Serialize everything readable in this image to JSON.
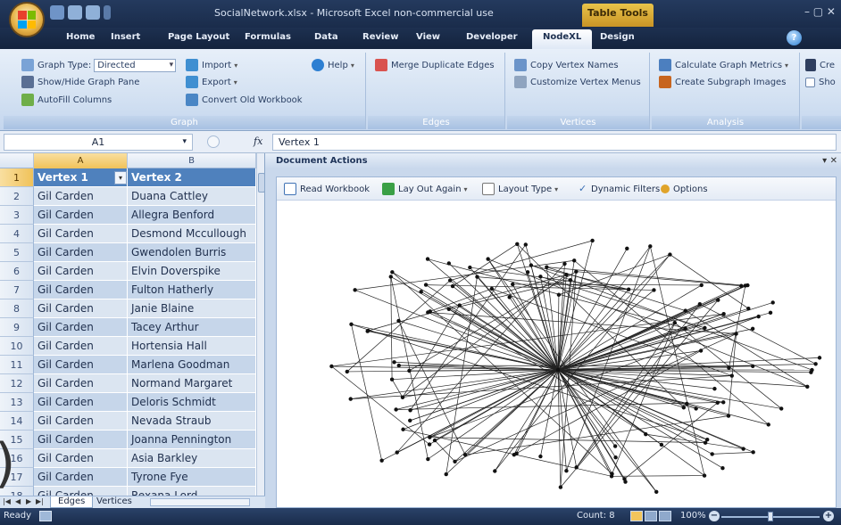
{
  "window": {
    "title": "SocialNetwork.xlsx - Microsoft Excel non-commercial use",
    "context_tab": "Table Tools",
    "controls": "– ▢ ✕"
  },
  "tabs": [
    "Home",
    "Insert",
    "Page Layout",
    "Formulas",
    "Data",
    "Review",
    "View",
    "Developer",
    "NodeXL",
    "Design"
  ],
  "active_tab": "NodeXL",
  "ribbon": {
    "graph": {
      "label": "Graph",
      "graph_type_label": "Graph Type:",
      "graph_type_value": "Directed",
      "show_hide": "Show/Hide Graph Pane",
      "autofill": "AutoFill Columns",
      "import": "Import",
      "export": "Export",
      "convert": "Convert Old Workbook",
      "help": "Help"
    },
    "edges": {
      "label": "Edges",
      "merge": "Merge Duplicate Edges"
    },
    "vertices": {
      "label": "Vertices",
      "copy": "Copy Vertex Names",
      "customize": "Customize Vertex Menus"
    },
    "analysis": {
      "label": "Analysis",
      "calculate": "Calculate Graph Metrics",
      "subgraph": "Create Subgraph Images",
      "cre": "Cre",
      "sho": "Sho"
    }
  },
  "formula_bar": {
    "name_box": "A1",
    "fx": "fx",
    "content": "Vertex 1"
  },
  "sheet": {
    "columns": [
      "A",
      "B"
    ],
    "header": [
      "Vertex 1",
      "Vertex 2"
    ],
    "rows": [
      [
        "Gil Carden",
        "Duana Cattley"
      ],
      [
        "Gil Carden",
        "Allegra Benford"
      ],
      [
        "Gil Carden",
        "Desmond Mccullough"
      ],
      [
        "Gil Carden",
        "Gwendolen Burris"
      ],
      [
        "Gil Carden",
        "Elvin Doverspike"
      ],
      [
        "Gil Carden",
        "Fulton Hatherly"
      ],
      [
        "Gil Carden",
        "Janie Blaine"
      ],
      [
        "Gil Carden",
        "Tacey Arthur"
      ],
      [
        "Gil Carden",
        "Hortensia Hall"
      ],
      [
        "Gil Carden",
        "Marlena Goodman"
      ],
      [
        "Gil Carden",
        "Normand Margaret"
      ],
      [
        "Gil Carden",
        "Deloris Schmidt"
      ],
      [
        "Gil Carden",
        "Nevada Straub"
      ],
      [
        "Gil Carden",
        "Joanna Pennington"
      ],
      [
        "Gil Carden",
        "Asia Barkley"
      ],
      [
        "Gil Carden",
        "Tyrone Fye"
      ],
      [
        "Gil Carden",
        "Rexana Lord"
      ]
    ],
    "sheet_tabs": [
      "Edges",
      "Vertices"
    ],
    "active_sheet": "Edges"
  },
  "pane": {
    "title": "Document Actions",
    "toolbar": {
      "read_workbook": "Read Workbook",
      "lay_out_again": "Lay Out Again",
      "layout_type": "Layout Type",
      "dynamic_filters": "Dynamic Filters",
      "options": "Options"
    }
  },
  "status": {
    "ready": "Ready",
    "count": "Count: 8",
    "zoom": "100%"
  },
  "colors": {
    "header_blue": "#4f81bd",
    "band_blue": "#dbe5f1",
    "title_bar": "#1a2c4b"
  }
}
